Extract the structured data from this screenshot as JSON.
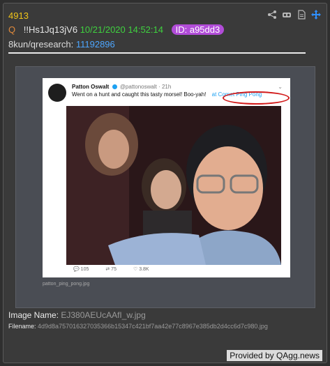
{
  "post": {
    "number": "4913",
    "marker": "Q",
    "tripcode": "!!Hs1Jq13jV6",
    "datetime": "10/21/2020 14:52:14",
    "id_badge": "ID: a95dd3",
    "board_prefix": "8kun/qresearch:",
    "post_link": "11192896"
  },
  "tools": [
    "share-icon",
    "glasses-icon",
    "document-icon",
    "move-icon"
  ],
  "tweet": {
    "name": "Patton Oswalt",
    "handle": "@pattonoswalt · 21h",
    "text": "Went on a hunt and caught this tasty morsel! Boo-yah!",
    "highlight": "at Comet Ping Pong",
    "replies": "105",
    "retweets": "75",
    "likes": "3.8K"
  },
  "image_caption": "patton_ping_pong.jpg",
  "image_name": {
    "label": "Image Name:",
    "value": "EJ380AEUcAAfI_w.jpg"
  },
  "filename": {
    "label": "Filename:",
    "value": "4d9d8a757016327035366b15347c421bf7aa42e77c8967e385db2d4cc6d7c980.jpg"
  },
  "footer": {
    "provided": "Provided by QAgg.news"
  },
  "colors": {
    "post_number": "#f0c419",
    "datetime": "#3fd13f",
    "id_badge": "#b14cd8",
    "link": "#4da6ff",
    "marker": "#e08a3c"
  }
}
